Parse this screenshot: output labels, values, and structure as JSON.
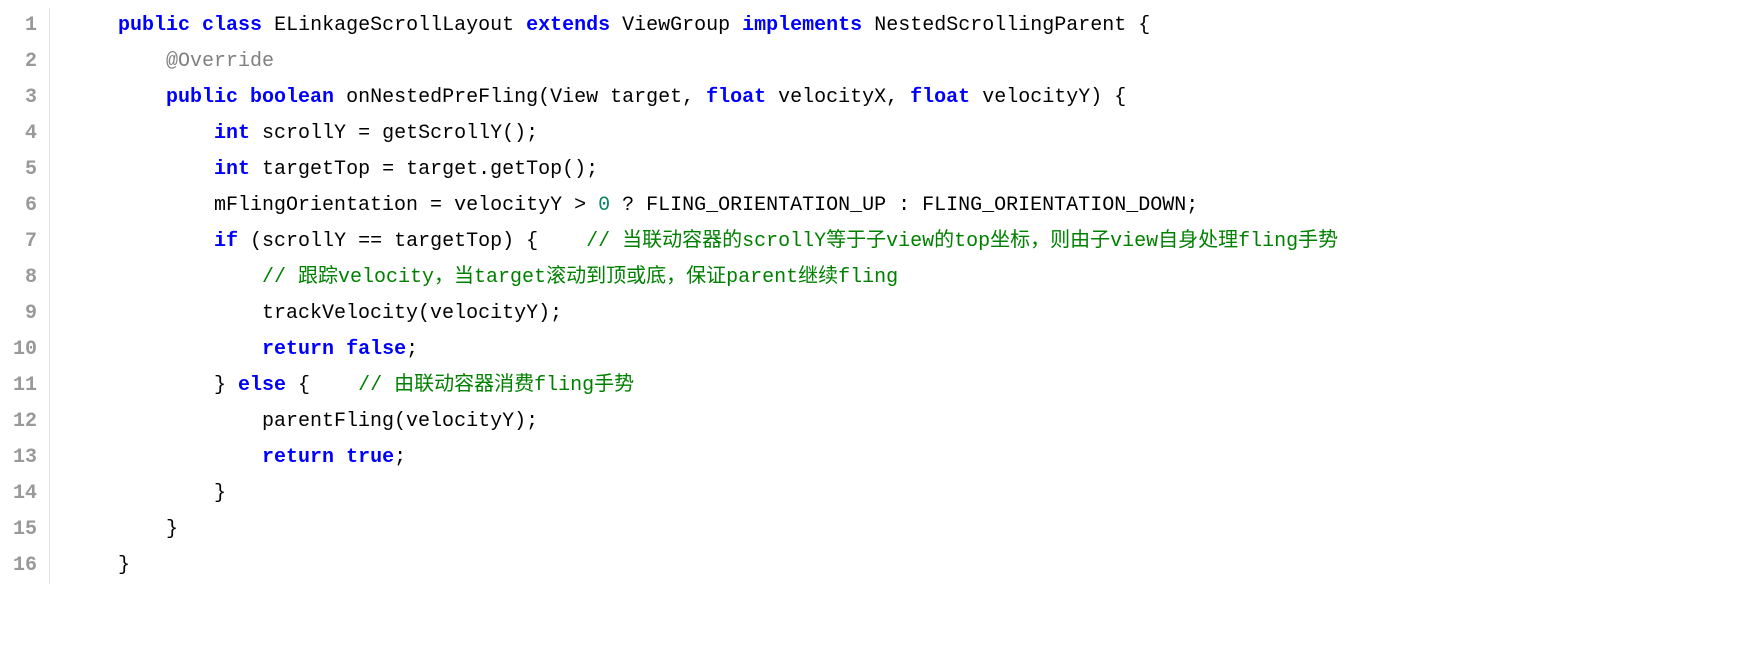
{
  "lines": [
    {
      "num": "1",
      "tokens": [
        {
          "t": "    ",
          "c": "plain"
        },
        {
          "t": "public",
          "c": "kw"
        },
        {
          "t": " ",
          "c": "plain"
        },
        {
          "t": "class",
          "c": "kw"
        },
        {
          "t": " ELinkageScrollLayout ",
          "c": "plain"
        },
        {
          "t": "extends",
          "c": "kw"
        },
        {
          "t": " ViewGroup ",
          "c": "plain"
        },
        {
          "t": "implements",
          "c": "kw"
        },
        {
          "t": " NestedScrollingParent {",
          "c": "plain"
        }
      ]
    },
    {
      "num": "2",
      "tokens": [
        {
          "t": "        ",
          "c": "plain"
        },
        {
          "t": "@Override",
          "c": "annotation"
        }
      ]
    },
    {
      "num": "3",
      "tokens": [
        {
          "t": "        ",
          "c": "plain"
        },
        {
          "t": "public",
          "c": "kw"
        },
        {
          "t": " ",
          "c": "plain"
        },
        {
          "t": "boolean",
          "c": "kw"
        },
        {
          "t": " onNestedPreFling(View target, ",
          "c": "plain"
        },
        {
          "t": "float",
          "c": "kw"
        },
        {
          "t": " velocityX, ",
          "c": "plain"
        },
        {
          "t": "float",
          "c": "kw"
        },
        {
          "t": " velocityY) {",
          "c": "plain"
        }
      ]
    },
    {
      "num": "4",
      "tokens": [
        {
          "t": "            ",
          "c": "plain"
        },
        {
          "t": "int",
          "c": "kw"
        },
        {
          "t": " scrollY = getScrollY();",
          "c": "plain"
        }
      ]
    },
    {
      "num": "5",
      "tokens": [
        {
          "t": "            ",
          "c": "plain"
        },
        {
          "t": "int",
          "c": "kw"
        },
        {
          "t": " targetTop = target.getTop();",
          "c": "plain"
        }
      ]
    },
    {
      "num": "6",
      "tokens": [
        {
          "t": "            mFlingOrientation = velocityY > ",
          "c": "plain"
        },
        {
          "t": "0",
          "c": "num"
        },
        {
          "t": " ? FLING_ORIENTATION_UP : FLING_ORIENTATION_DOWN;",
          "c": "plain"
        }
      ]
    },
    {
      "num": "7",
      "tokens": [
        {
          "t": "            ",
          "c": "plain"
        },
        {
          "t": "if",
          "c": "kw"
        },
        {
          "t": " (scrollY == targetTop) {    ",
          "c": "plain"
        },
        {
          "t": "// 当联动容器的scrollY等于子view的top坐标，则由子view自身处理fling手势",
          "c": "comment"
        }
      ]
    },
    {
      "num": "8",
      "tokens": [
        {
          "t": "                ",
          "c": "plain"
        },
        {
          "t": "// 跟踪velocity，当target滚动到顶或底，保证parent继续fling",
          "c": "comment"
        }
      ]
    },
    {
      "num": "9",
      "tokens": [
        {
          "t": "                trackVelocity(velocityY);",
          "c": "plain"
        }
      ]
    },
    {
      "num": "10",
      "tokens": [
        {
          "t": "                ",
          "c": "plain"
        },
        {
          "t": "return",
          "c": "kw"
        },
        {
          "t": " ",
          "c": "plain"
        },
        {
          "t": "false",
          "c": "kw"
        },
        {
          "t": ";",
          "c": "plain"
        }
      ]
    },
    {
      "num": "11",
      "tokens": [
        {
          "t": "            } ",
          "c": "plain"
        },
        {
          "t": "else",
          "c": "kw"
        },
        {
          "t": " {    ",
          "c": "plain"
        },
        {
          "t": "// 由联动容器消费fling手势",
          "c": "comment"
        }
      ]
    },
    {
      "num": "12",
      "tokens": [
        {
          "t": "                parentFling(velocityY);",
          "c": "plain"
        }
      ]
    },
    {
      "num": "13",
      "tokens": [
        {
          "t": "                ",
          "c": "plain"
        },
        {
          "t": "return",
          "c": "kw"
        },
        {
          "t": " ",
          "c": "plain"
        },
        {
          "t": "true",
          "c": "kw"
        },
        {
          "t": ";",
          "c": "plain"
        }
      ]
    },
    {
      "num": "14",
      "tokens": [
        {
          "t": "            }",
          "c": "plain"
        }
      ]
    },
    {
      "num": "15",
      "tokens": [
        {
          "t": "        }",
          "c": "plain"
        }
      ]
    },
    {
      "num": "16",
      "tokens": [
        {
          "t": "    }",
          "c": "plain"
        }
      ]
    }
  ]
}
